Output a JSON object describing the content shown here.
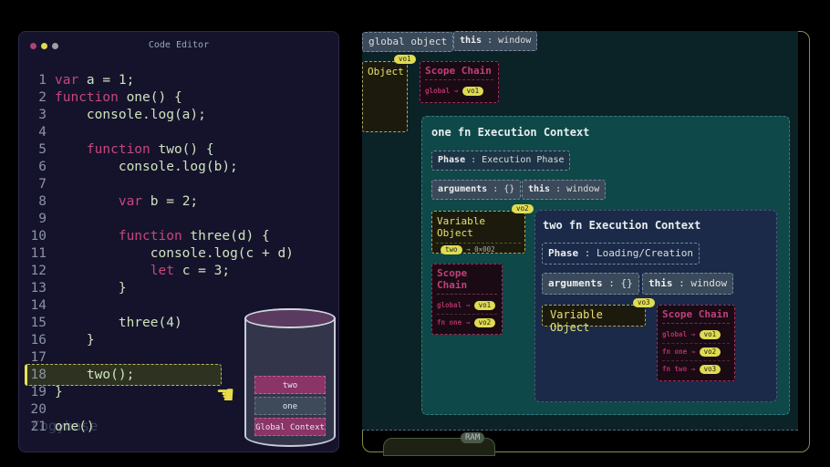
{
  "editor": {
    "title": "Code Editor",
    "window_dots": [
      "#b0407a",
      "#e0d850",
      "#9aa0a8"
    ],
    "lines": [
      {
        "n": "1",
        "kw": "var",
        "rest": " a = 1;",
        "indent": ""
      },
      {
        "n": "2",
        "kw": "function",
        "rest": " one() {",
        "indent": ""
      },
      {
        "n": "3",
        "kw": "",
        "rest": "console.log(a);",
        "indent": "    "
      },
      {
        "n": "4",
        "kw": "",
        "rest": "",
        "indent": ""
      },
      {
        "n": "5",
        "kw": "function",
        "rest": " two() {",
        "indent": "    "
      },
      {
        "n": "6",
        "kw": "",
        "rest": "console.log(b);",
        "indent": "        "
      },
      {
        "n": "7",
        "kw": "",
        "rest": "",
        "indent": ""
      },
      {
        "n": "8",
        "kw": "var",
        "rest": " b = 2;",
        "indent": "        "
      },
      {
        "n": "9",
        "kw": "",
        "rest": "",
        "indent": ""
      },
      {
        "n": "10",
        "kw": "function",
        "rest": " three(d) {",
        "indent": "        "
      },
      {
        "n": "11",
        "kw": "",
        "rest": "console.log(c + d)",
        "indent": "            "
      },
      {
        "n": "12",
        "kw": "let",
        "rest": " c = 3;",
        "indent": "            "
      },
      {
        "n": "13",
        "kw": "",
        "rest": "}",
        "indent": "        "
      },
      {
        "n": "14",
        "kw": "",
        "rest": "",
        "indent": ""
      },
      {
        "n": "15",
        "kw": "",
        "rest": "three(4)",
        "indent": "        "
      },
      {
        "n": "16",
        "kw": "",
        "rest": "}",
        "indent": "    "
      },
      {
        "n": "17",
        "kw": "",
        "rest": "",
        "indent": ""
      },
      {
        "n": "18",
        "kw": "",
        "rest": "two();",
        "indent": "    "
      },
      {
        "n": "19",
        "kw": "",
        "rest": "}",
        "indent": ""
      },
      {
        "n": "20",
        "kw": "",
        "rest": "",
        "indent": ""
      },
      {
        "n": "21",
        "kw": "",
        "rest": "one()",
        "indent": ""
      }
    ],
    "highlighted_line": "18",
    "ghost_text": "Cogybase"
  },
  "call_stack": {
    "frames": [
      "two",
      "one",
      "Global Context"
    ],
    "colors": {
      "two": "#8a3468",
      "one": "#3e4a5a",
      "global": "#8a3468"
    }
  },
  "memory": {
    "label": "RAM",
    "global": {
      "object_tab": "global object",
      "this_key": "this",
      "this_val": "window",
      "vo_title": "Object",
      "vo_badge": "vo1",
      "scope_title": "Scope Chain",
      "scope_rows": [
        {
          "k": "global →",
          "v": "vo1"
        }
      ]
    },
    "one_ec": {
      "title": "one fn Execution Context",
      "phase_key": "Phase",
      "phase_val": "Execution Phase",
      "args_key": "arguments",
      "args_val": "{}",
      "this_key": "this",
      "this_val": "window",
      "vo_title": "Variable Object",
      "vo_badge": "vo2",
      "vo_entry_key": "two",
      "vo_entry_val": "→ 0×002",
      "scope_title": "Scope Chain",
      "scope_rows": [
        {
          "k": "global →",
          "v": "vo1"
        },
        {
          "k": "fn one →",
          "v": "vo2"
        }
      ]
    },
    "two_ec": {
      "title": "two fn Execution Context",
      "phase_key": "Phase",
      "phase_val": "Loading/Creation",
      "args_key": "arguments",
      "args_val": "{}",
      "this_key": "this",
      "this_val": "window",
      "vo_title": "Variable Object",
      "vo_badge": "vo3",
      "scope_title": "Scope Chain",
      "scope_rows": [
        {
          "k": "global →",
          "v": "vo1"
        },
        {
          "k": "fn one →",
          "v": "vo2"
        },
        {
          "k": "fn two →",
          "v": "vo3"
        }
      ]
    }
  }
}
